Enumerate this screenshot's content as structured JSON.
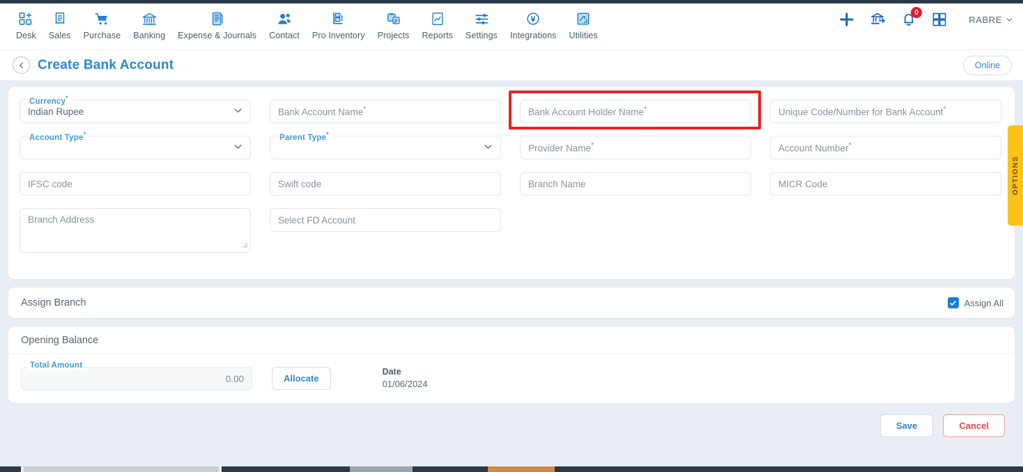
{
  "app": {
    "user": "RABRE",
    "notification_count": "0"
  },
  "nav": [
    {
      "label": "Desk",
      "icon": "desk-grid-plus-icon"
    },
    {
      "label": "Sales",
      "icon": "sales-receipt-icon"
    },
    {
      "label": "Purchase",
      "icon": "purchase-cart-icon"
    },
    {
      "label": "Banking",
      "icon": "banking-bank-icon"
    },
    {
      "label": "Expense & Journals",
      "icon": "expense-journal-book-icon"
    },
    {
      "label": "Contact",
      "icon": "contact-people-icon"
    },
    {
      "label": "Pro Inventory",
      "icon": "pro-inventory-forklift-icon"
    },
    {
      "label": "Projects",
      "icon": "projects-clipboard-icon"
    },
    {
      "label": "Reports",
      "icon": "reports-chart-page-icon"
    },
    {
      "label": "Settings",
      "icon": "settings-sliders-icon"
    },
    {
      "label": "Integrations",
      "icon": "integrations-plug-icon"
    },
    {
      "label": "Utilities",
      "icon": "utilities-tools-icon"
    }
  ],
  "header_actions": [
    {
      "name": "add-new-icon",
      "label": "+"
    },
    {
      "name": "bank-transfer-icon",
      "label": ""
    },
    {
      "name": "notification-bell-icon",
      "label": ""
    },
    {
      "name": "apps-grid-icon",
      "label": ""
    }
  ],
  "titlebar": {
    "back_icon": "chevron-left-icon",
    "title": "Create Bank Account",
    "online_label": "Online"
  },
  "options_tab": {
    "label": "OPTIONS"
  },
  "form": {
    "fields": [
      {
        "name": "currency",
        "type": "select",
        "label": "Currency",
        "required": true,
        "value": "Indian Rupee",
        "placeholder": "",
        "floated": true,
        "col": 1,
        "row": 1
      },
      {
        "name": "bank-account-name",
        "type": "text",
        "label": "",
        "required": true,
        "value": "",
        "placeholder": "Bank Account Name",
        "floated": false,
        "col": 2,
        "row": 1
      },
      {
        "name": "bank-account-holder-name",
        "type": "text",
        "label": "",
        "required": true,
        "value": "",
        "placeholder": "Bank Account Holder Name",
        "floated": false,
        "col": 3,
        "row": 1,
        "highlighted": true
      },
      {
        "name": "unique-code-number-for-bank-account",
        "type": "text",
        "label": "",
        "required": true,
        "value": "",
        "placeholder": "Unique Code/Number for Bank Account",
        "floated": false,
        "col": 4,
        "row": 1
      },
      {
        "name": "account-type",
        "type": "select",
        "label": "Account Type",
        "required": true,
        "value": "",
        "placeholder": "",
        "floated": true,
        "col": 1,
        "row": 2
      },
      {
        "name": "parent-type",
        "type": "select",
        "label": "Parent Type",
        "required": true,
        "value": "",
        "placeholder": "",
        "floated": true,
        "col": 2,
        "row": 2
      },
      {
        "name": "provider-name",
        "type": "text",
        "label": "",
        "required": true,
        "value": "",
        "placeholder": "Provider Name",
        "floated": false,
        "col": 3,
        "row": 2
      },
      {
        "name": "account-number",
        "type": "text",
        "label": "",
        "required": true,
        "value": "",
        "placeholder": "Account Number",
        "floated": false,
        "col": 4,
        "row": 2
      },
      {
        "name": "ifsc-code",
        "type": "text",
        "label": "",
        "required": false,
        "value": "",
        "placeholder": "IFSC code",
        "floated": false,
        "col": 1,
        "row": 3
      },
      {
        "name": "swift-code",
        "type": "text",
        "label": "",
        "required": false,
        "value": "",
        "placeholder": "Swift code",
        "floated": false,
        "col": 2,
        "row": 3
      },
      {
        "name": "branch-name",
        "type": "text",
        "label": "",
        "required": false,
        "value": "",
        "placeholder": "Branch Name",
        "floated": false,
        "col": 3,
        "row": 3
      },
      {
        "name": "micr-code",
        "type": "text",
        "label": "",
        "required": false,
        "value": "",
        "placeholder": "MICR Code",
        "floated": false,
        "col": 4,
        "row": 3
      },
      {
        "name": "branch-address",
        "type": "textarea",
        "label": "",
        "required": false,
        "value": "",
        "placeholder": "Branch Address",
        "floated": false,
        "col": 1,
        "row": 4
      },
      {
        "name": "select-fd-account",
        "type": "select-plain",
        "label": "",
        "required": false,
        "value": "",
        "placeholder": "Select FD Account",
        "floated": false,
        "col": 2,
        "row": 4
      }
    ]
  },
  "assign_branch": {
    "title": "Assign Branch",
    "assign_all_label": "Assign All",
    "assign_all_checked": true,
    "check_icon": "check-icon"
  },
  "opening_balance": {
    "title": "Opening Balance",
    "total_amount_label": "Total Amount",
    "total_amount_value": "0.00",
    "allocate_label": "Allocate",
    "date_label": "Date",
    "date_value": "01/06/2024"
  },
  "footer": {
    "save_label": "Save",
    "cancel_label": "Cancel"
  },
  "colors": {
    "accent_blue": "#2f86d0",
    "title_blue": "#3f9ada",
    "highlight_red": "#e82127",
    "options_yellow": "#fdc117",
    "badge_red": "#e8192c",
    "page_bg": "#e9eef5",
    "checkbox_blue": "#1a7fd4",
    "cancel_red": "#e8444c"
  }
}
